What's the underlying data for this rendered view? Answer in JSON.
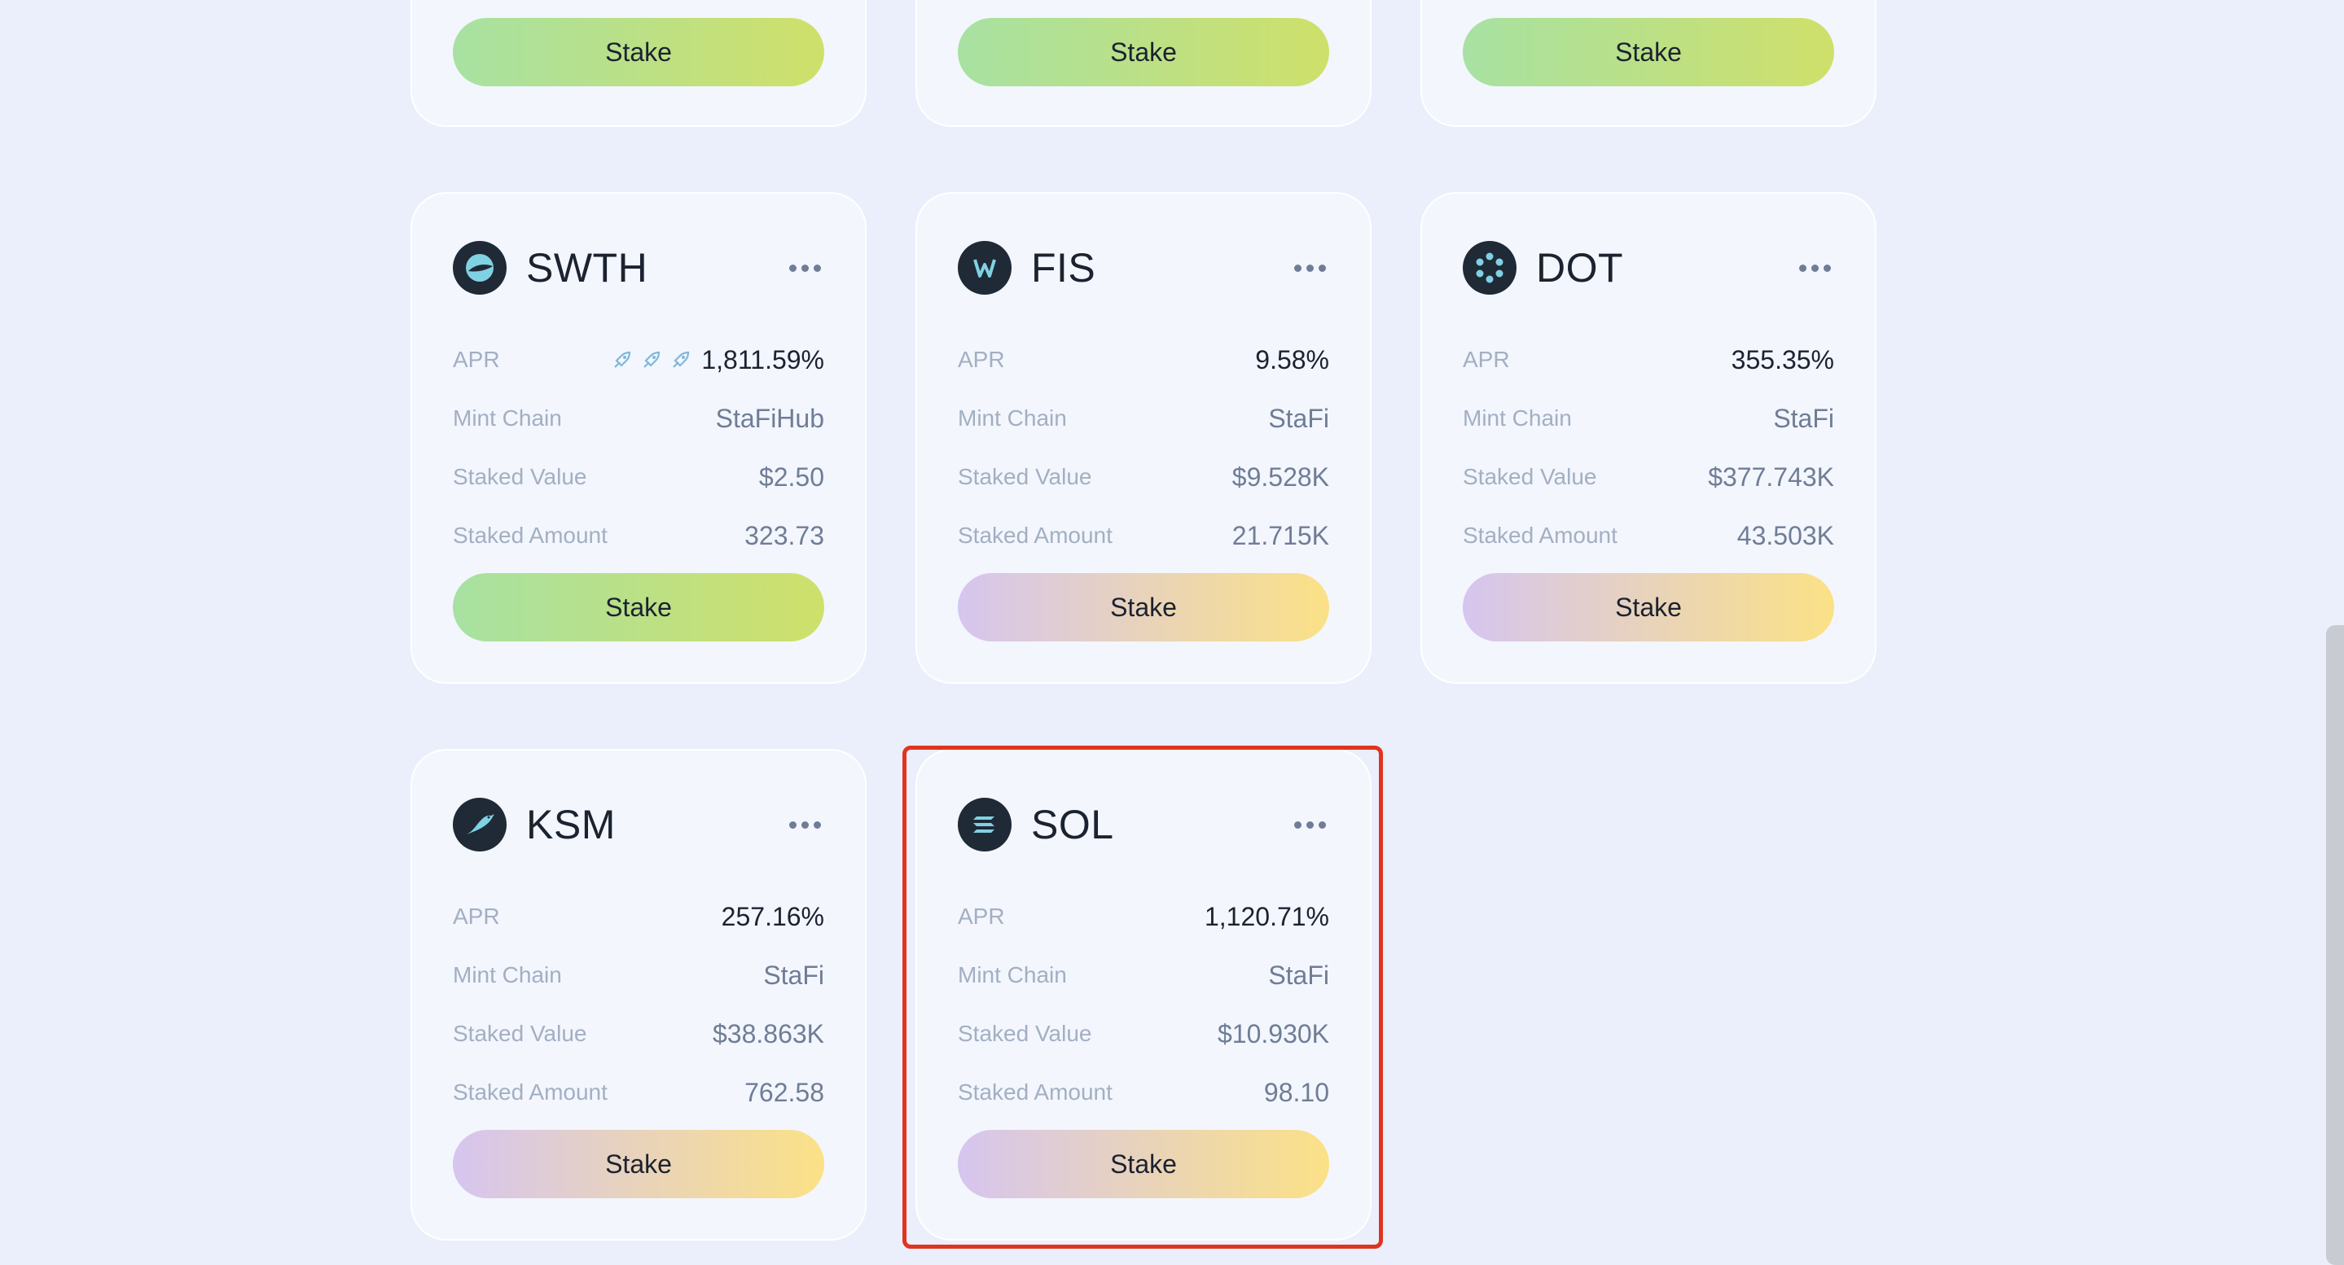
{
  "cards_top_partial": [
    {
      "stake_label": "Stake",
      "button_style": "green"
    },
    {
      "stake_label": "Stake",
      "button_style": "green"
    },
    {
      "stake_label": "Stake",
      "button_style": "green"
    }
  ],
  "cards": [
    {
      "token": "SWTH",
      "icon": "swth-logo-icon",
      "apr_label": "APR",
      "apr_value": "1,811.59%",
      "apr_rockets": 3,
      "mint_chain_label": "Mint Chain",
      "mint_chain_value": "StaFiHub",
      "staked_value_label": "Staked Value",
      "staked_value": "$2.50",
      "staked_amount_label": "Staked Amount",
      "staked_amount": "323.73",
      "stake_label": "Stake",
      "button_style": "green"
    },
    {
      "token": "FIS",
      "icon": "fis-logo-icon",
      "apr_label": "APR",
      "apr_value": "9.58%",
      "mint_chain_label": "Mint Chain",
      "mint_chain_value": "StaFi",
      "staked_value_label": "Staked Value",
      "staked_value": "$9.528K",
      "staked_amount_label": "Staked Amount",
      "staked_amount": "21.715K",
      "stake_label": "Stake",
      "button_style": "purple"
    },
    {
      "token": "DOT",
      "icon": "dot-logo-icon",
      "apr_label": "APR",
      "apr_value": "355.35%",
      "mint_chain_label": "Mint Chain",
      "mint_chain_value": "StaFi",
      "staked_value_label": "Staked Value",
      "staked_value": "$377.743K",
      "staked_amount_label": "Staked Amount",
      "staked_amount": "43.503K",
      "stake_label": "Stake",
      "button_style": "purple"
    },
    {
      "token": "KSM",
      "icon": "ksm-logo-icon",
      "apr_label": "APR",
      "apr_value": "257.16%",
      "mint_chain_label": "Mint Chain",
      "mint_chain_value": "StaFi",
      "staked_value_label": "Staked Value",
      "staked_value": "$38.863K",
      "staked_amount_label": "Staked Amount",
      "staked_amount": "762.58",
      "stake_label": "Stake",
      "button_style": "purple"
    },
    {
      "token": "SOL",
      "icon": "sol-logo-icon",
      "apr_label": "APR",
      "apr_value": "1,120.71%",
      "mint_chain_label": "Mint Chain",
      "mint_chain_value": "StaFi",
      "staked_value_label": "Staked Value",
      "staked_value": "$10.930K",
      "staked_amount_label": "Staked Amount",
      "staked_amount": "98.10",
      "stake_label": "Stake",
      "button_style": "purple",
      "highlighted": true
    }
  ],
  "colors": {
    "background": "#eaeffb",
    "card": "#f3f6fd",
    "highlight_border": "#e0341f",
    "green_gradient": [
      "#a7e1a2",
      "#cfe06a"
    ],
    "purple_gradient": [
      "#d6c5ef",
      "#fbe186"
    ]
  }
}
